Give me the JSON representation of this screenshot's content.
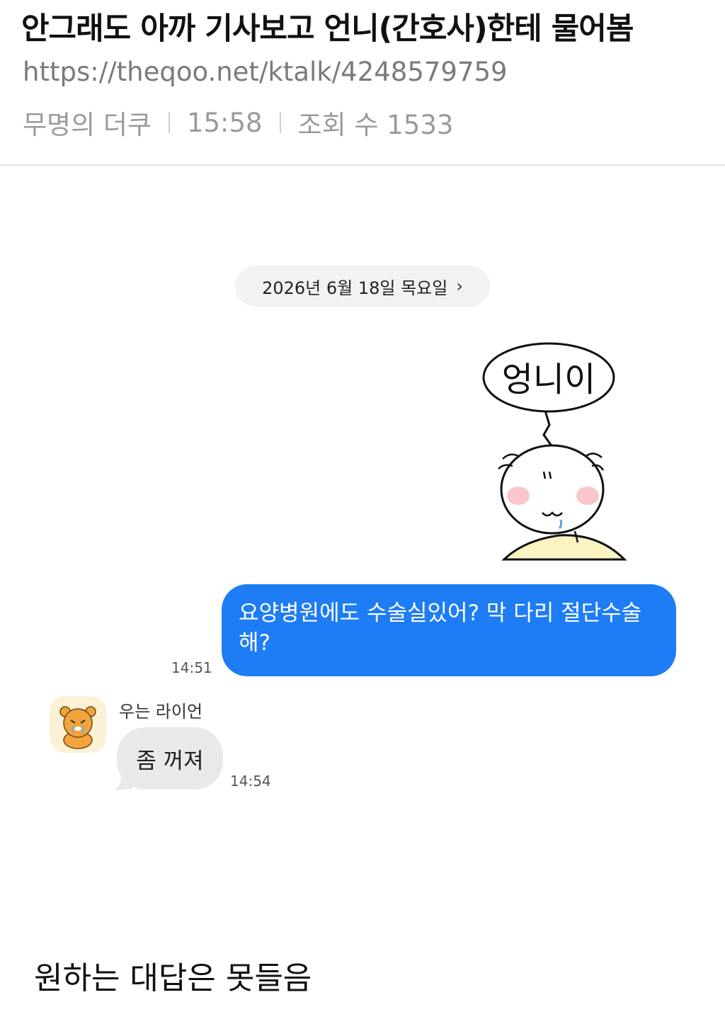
{
  "post": {
    "title": "안그래도 아까 기사보고 언니(간호사)한테 물어봄",
    "url": "https://theqoo.net/ktalk/4248579759",
    "author": "무명의 더쿠",
    "time": "15:58",
    "views": "조회 수 1533"
  },
  "chat": {
    "date_chip": "2026년 6월 18일 목요일",
    "sticker_text": "엉니이",
    "outgoing": {
      "text_line1": "요양병원에도 수술실있어? 막 다리 절단수술",
      "text_line2": "해?",
      "time": "14:51"
    },
    "incoming": {
      "sender": "우는 라이언",
      "text": "좀 꺼져",
      "time": "14:54"
    }
  },
  "caption": "원하는 대답은 못들음",
  "colors": {
    "outgoing_bubble": "#1e7cf5",
    "incoming_bubble": "#e9e9eb",
    "date_chip": "#f1f2f4"
  }
}
